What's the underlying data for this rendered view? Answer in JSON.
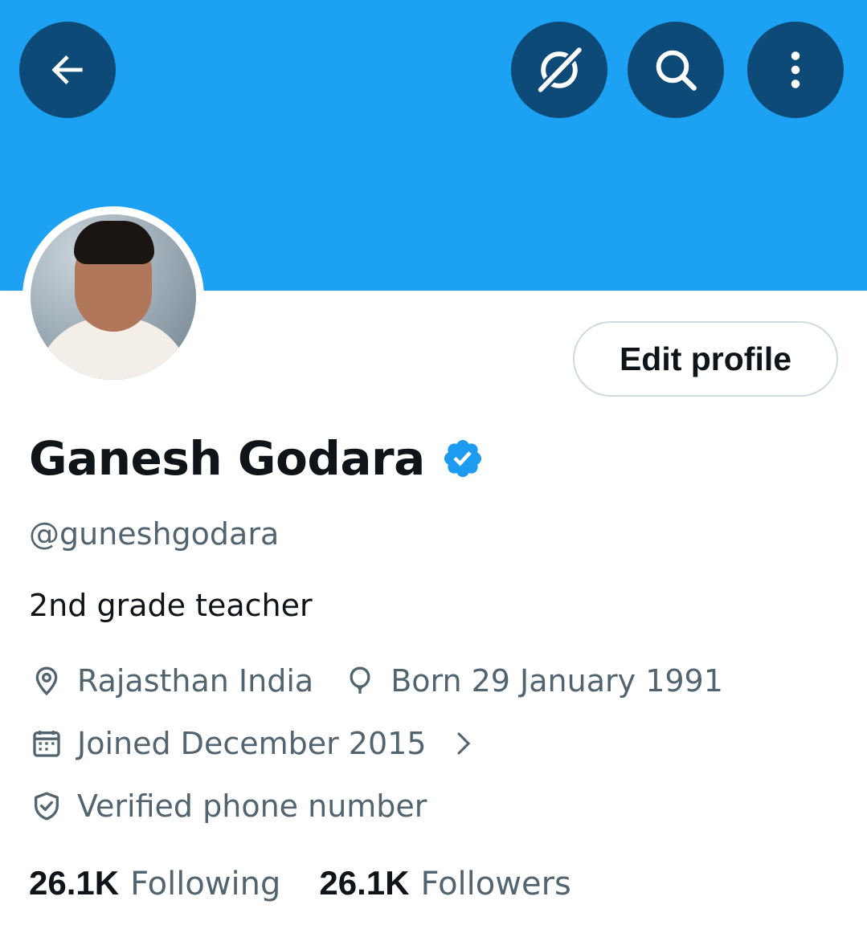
{
  "header": {
    "banner_color": "#1da1f2",
    "button_color": "#0d4a78",
    "buttons": [
      {
        "name": "back",
        "icon": "arrow-left-icon"
      },
      {
        "name": "grok",
        "icon": "grok-icon"
      },
      {
        "name": "search",
        "icon": "search-icon"
      },
      {
        "name": "more",
        "icon": "more-vertical-icon"
      }
    ]
  },
  "profile": {
    "edit_label": "Edit profile",
    "name": "Ganesh Godara",
    "verified_color": "#1d9bf0",
    "handle": "@guneshgodara",
    "bio": "2nd grade teacher",
    "location": "Rajasthan India",
    "birthday": "Born 29 January 1991",
    "joined": "Joined December 2015",
    "phone_verified": "Verified phone number"
  },
  "stats": {
    "following_count": "26.1K",
    "following_label": "Following",
    "followers_count": "26.1K",
    "followers_label": "Followers"
  }
}
